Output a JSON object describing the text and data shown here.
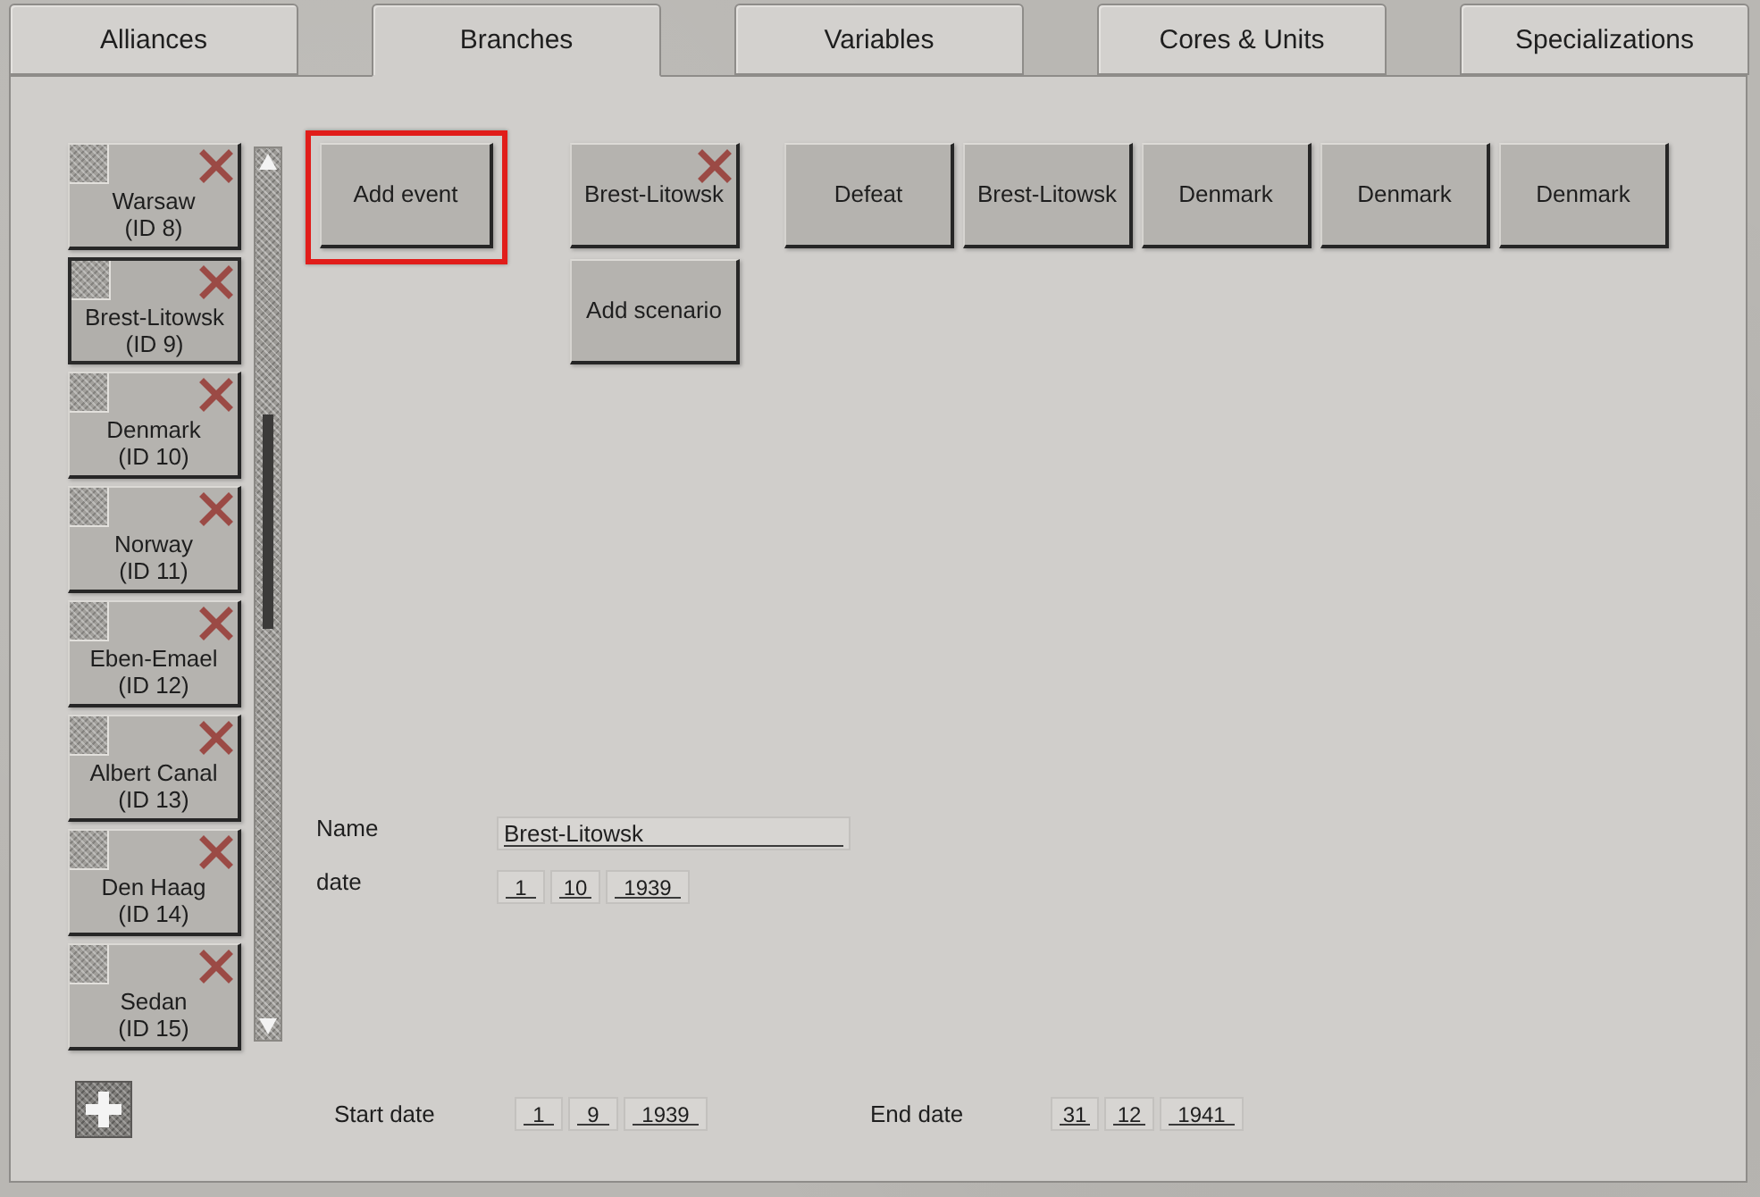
{
  "tabs": [
    {
      "label": "Alliances",
      "selected": false
    },
    {
      "label": "Branches",
      "selected": true
    },
    {
      "label": "Variables",
      "selected": false
    },
    {
      "label": "Cores & Units",
      "selected": false
    },
    {
      "label": "Specializations",
      "selected": false
    }
  ],
  "branches": {
    "items": [
      {
        "name": "Warsaw",
        "id_label": "(ID 8)",
        "selected": false
      },
      {
        "name": "Brest-Litowsk",
        "id_label": "(ID 9)",
        "selected": true
      },
      {
        "name": "Denmark",
        "id_label": "(ID 10)",
        "selected": false
      },
      {
        "name": "Norway",
        "id_label": "(ID 11)",
        "selected": false
      },
      {
        "name": "Eben-Emael",
        "id_label": "(ID 12)",
        "selected": false
      },
      {
        "name": "Albert Canal",
        "id_label": "(ID 13)",
        "selected": false
      },
      {
        "name": "Den Haag",
        "id_label": "(ID 14)",
        "selected": false
      },
      {
        "name": "Sedan",
        "id_label": "(ID 15)",
        "selected": false
      }
    ]
  },
  "add_event_button": {
    "label": "Add event",
    "highlighted": true
  },
  "scenarios": [
    {
      "kind": "scenario",
      "label": "Brest-Litowsk"
    },
    {
      "kind": "add",
      "label": "Add scenario"
    }
  ],
  "button_row": [
    {
      "label": "Defeat"
    },
    {
      "label": "Brest-Litowsk"
    },
    {
      "label": "Denmark"
    },
    {
      "label": "Denmark"
    },
    {
      "label": "Denmark"
    }
  ],
  "form": [
    {
      "kind": "text",
      "label": "Name",
      "value": "Brest-Litowsk"
    },
    {
      "kind": "date",
      "label": "date",
      "parts": [
        "1",
        "10",
        "1939"
      ]
    }
  ],
  "range": [
    {
      "label": "Start date",
      "parts": [
        "1",
        "9",
        "1939"
      ]
    },
    {
      "label": "End date",
      "parts": [
        "31",
        "12",
        "1941"
      ]
    }
  ]
}
